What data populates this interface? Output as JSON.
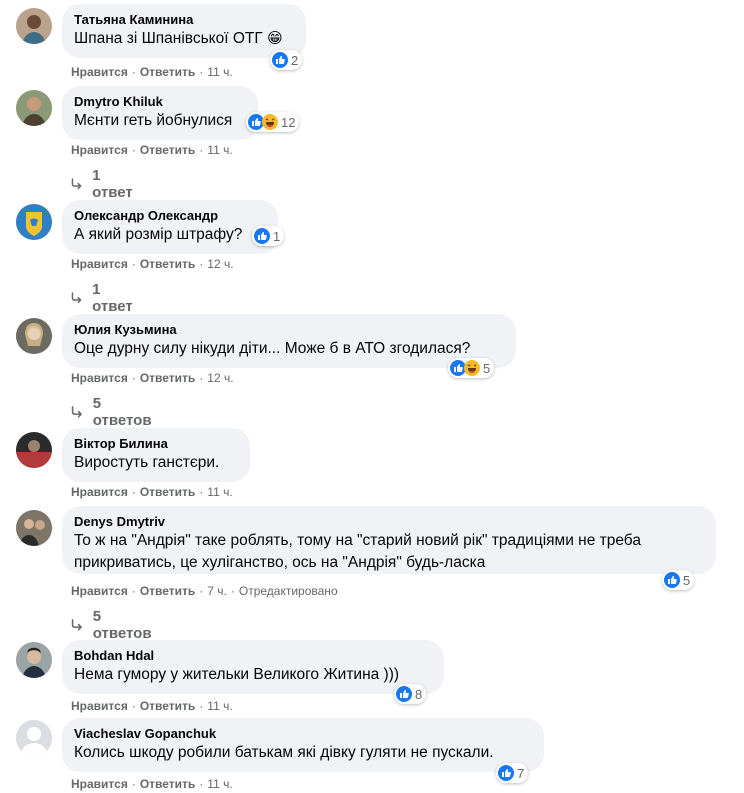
{
  "comments": [
    {
      "author": "Татьяна Каминина",
      "text": "Шпана зі Шпанівської ОТГ",
      "emoji": "😁",
      "reaction_count": "2",
      "like": "Нравится",
      "reply": "Ответить",
      "time": "11 ч."
    },
    {
      "author": "Dmytro Khiluk",
      "text": "Мєнти геть йобнулися",
      "reaction_count": "12",
      "like": "Нравится",
      "reply": "Ответить",
      "time": "11 ч.",
      "replies": "1 ответ"
    },
    {
      "author": "Олександр Олександр",
      "text": "А який розмір штрафу?",
      "reaction_count": "1",
      "like": "Нравится",
      "reply": "Ответить",
      "time": "12 ч.",
      "replies": "1 ответ"
    },
    {
      "author": "Юлия Кузьмина",
      "text": "Оце дурну силу нікуди діти... Може б в АТО згодилася?",
      "reaction_count": "5",
      "like": "Нравится",
      "reply": "Ответить",
      "time": "12 ч.",
      "replies": "5 ответов"
    },
    {
      "author": "Віктор Билина",
      "text": "Виростуть ганстєри.",
      "like": "Нравится",
      "reply": "Ответить",
      "time": "11 ч."
    },
    {
      "author": "Denys Dmytriv",
      "text_line1": "То ж на \"Андрія\" таке роблять, тому на \"старий новий рік\" традиціями не треба",
      "text_line2": "прикриватись, це хуліганство, ось на \"Андрія\" будь-ласка",
      "reaction_count": "5",
      "like": "Нравится",
      "reply": "Ответить",
      "time": "7 ч.",
      "edited": "Отредактировано",
      "replies": "5 ответов"
    },
    {
      "author": "Bohdan Hdal",
      "text": "Нема гумору у жительки Великого Житина )))",
      "reaction_count": "8",
      "like": "Нравится",
      "reply": "Ответить",
      "time": "11 ч."
    },
    {
      "author": "Viacheslav Gopanchuk",
      "text": "Колись шкоду робили батькам які дівку гуляти не пускали.",
      "reaction_count": "7",
      "like": "Нравится",
      "reply": "Ответить",
      "time": "11 ч."
    }
  ],
  "colors": {
    "like_blue": "#1877f2",
    "haha_yellow": "#f7b928",
    "bubble": "#f0f2f5",
    "meta_gray": "#65676b"
  },
  "icons": {
    "like": "like-reaction-icon",
    "haha": "haha-reaction-icon",
    "reply_arrow": "reply-arrow-icon"
  }
}
